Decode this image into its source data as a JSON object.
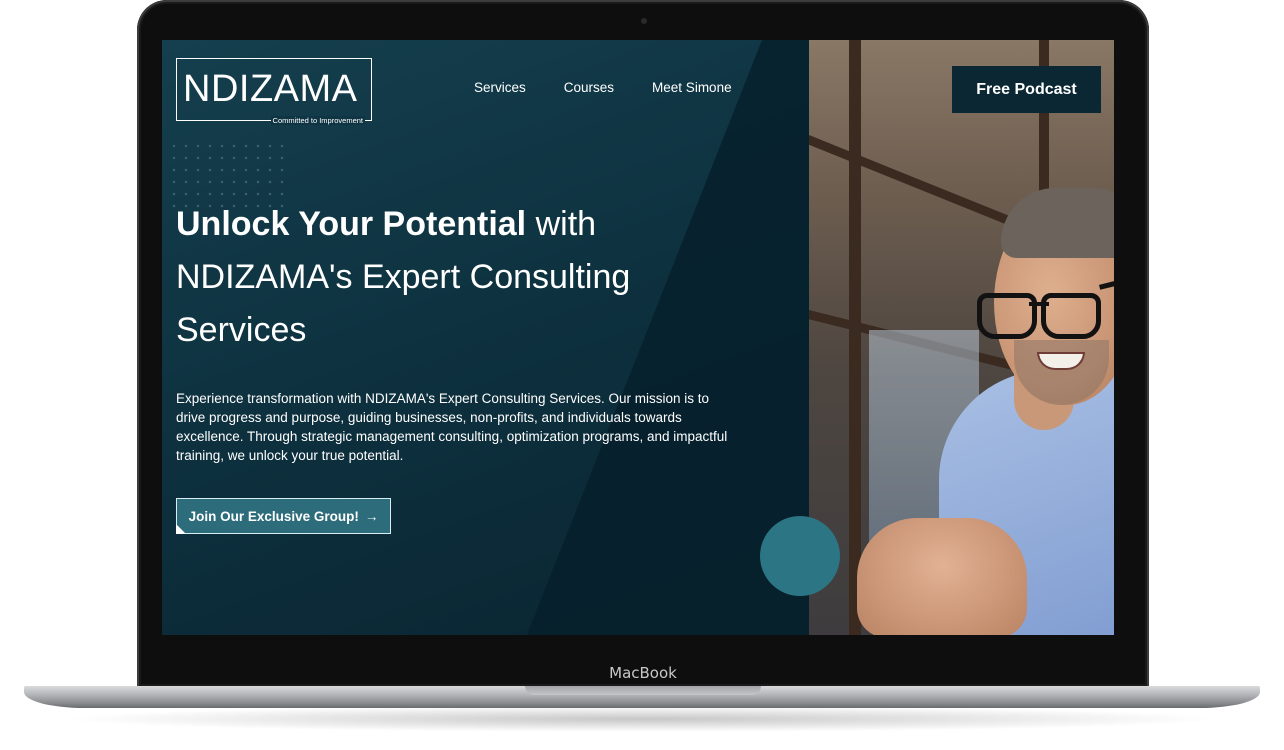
{
  "device": {
    "brand_label": "MacBook"
  },
  "header": {
    "logo_text": "NDIZAMA",
    "logo_tagline": "Committed to Improvement",
    "nav": [
      {
        "label": "Services"
      },
      {
        "label": "Courses"
      },
      {
        "label": "Meet Simone"
      }
    ],
    "podcast_button": "Free Podcast"
  },
  "hero": {
    "headline_bold": "Unlock Your Potential",
    "headline_rest": " with NDIZAMA's Expert Consulting Services",
    "description": "Experience transformation with NDIZAMA's Expert Consulting Services. Our mission is to drive progress and purpose, guiding businesses, non-profits, and individuals towards excellence. Through strategic management consulting, optimization programs, and impactful training, we unlock your true potential.",
    "cta_label": "Join Our Exclusive Group!",
    "cta_icon": "→"
  },
  "colors": {
    "hero_bg": "#0e3240",
    "cta_bg": "#2d6c7a",
    "podcast_bg": "#0b2733",
    "accent_circle": "#2c7585"
  },
  "icons": {
    "cta_arrow": "arrow-right-icon"
  }
}
